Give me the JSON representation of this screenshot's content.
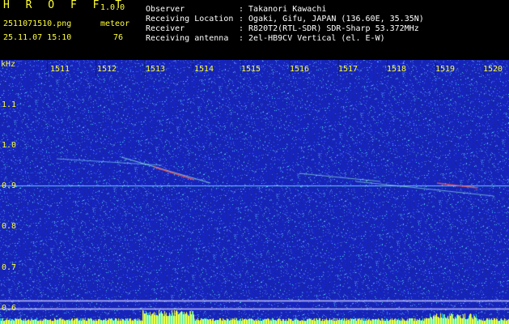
{
  "app": {
    "name": "H R O F F T",
    "version": "1.0.0"
  },
  "file": {
    "name": "2511071510.png",
    "datetime": "25.11.07 15:10"
  },
  "meteor": {
    "label": "meteor",
    "count": "76"
  },
  "info": [
    {
      "label": "Observer",
      "value": ": Takanori Kawachi"
    },
    {
      "label": "Receiving Location",
      "value": ": Ogaki, Gifu, JAPAN (136.60E, 35.35N)"
    },
    {
      "label": "Receiver",
      "value": ": R820T2(RTL-SDR) SDR-Sharp 53.372MHz"
    },
    {
      "label": "Receiving antenna",
      "value": ": 2el-HB9CV Vertical (el. E-W)"
    }
  ],
  "axis": {
    "y_unit": "kHz",
    "x_ticks": [
      "1511",
      "1512",
      "1513",
      "1514",
      "1515",
      "1516",
      "1517",
      "1518",
      "1519",
      "1520"
    ],
    "y_ticks": [
      "1.1",
      "1.0",
      "0.9",
      "0.8",
      "0.7",
      "0.6"
    ]
  },
  "colors": {
    "text": "#ffff3a",
    "label": "#ffffff",
    "background": "#1a2fb0",
    "signal": "#18e0f0"
  }
}
